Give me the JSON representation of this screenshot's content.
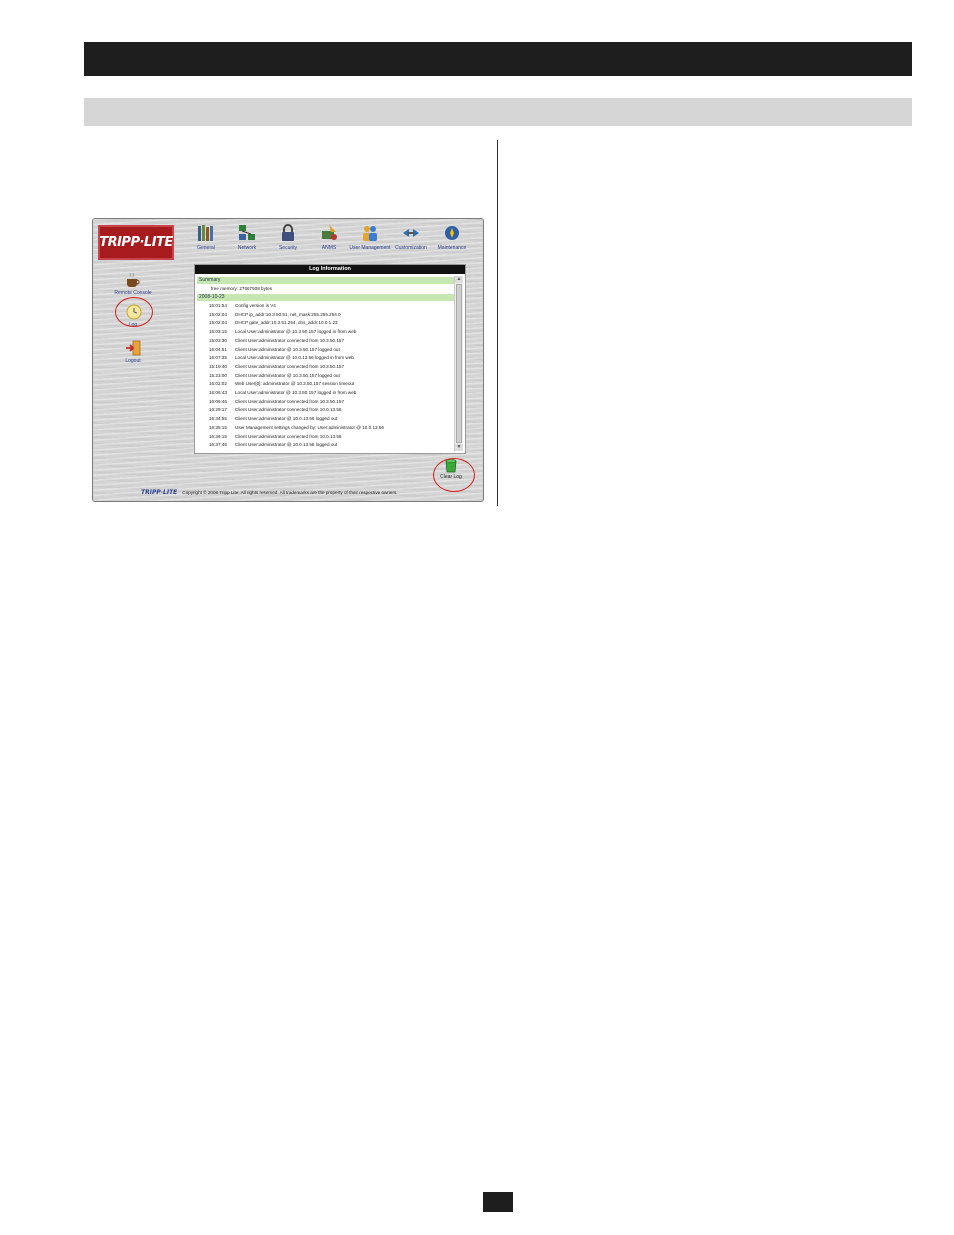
{
  "app": {
    "logo": "TRIPP·LITE",
    "footer_logo": "TRIPP·LITE",
    "copyright": "Copyright © 2008 Tripp Lite. All rights reserved. All trademarks are the property of their respective owners."
  },
  "nav": {
    "items": [
      {
        "label": "General",
        "icon": "books-icon"
      },
      {
        "label": "Network",
        "icon": "network-icon"
      },
      {
        "label": "Security",
        "icon": "lock-icon"
      },
      {
        "label": "ANMS",
        "icon": "anms-icon"
      },
      {
        "label": "User Management",
        "icon": "users-icon"
      },
      {
        "label": "Customization",
        "icon": "customization-icon"
      },
      {
        "label": "Maintenance",
        "icon": "maintenance-icon"
      }
    ]
  },
  "sidebar": {
    "items": [
      {
        "label": "Remote Console",
        "icon": "coffee-icon"
      },
      {
        "label": "Log",
        "icon": "log-icon"
      },
      {
        "label": "Logout",
        "icon": "logout-icon"
      }
    ]
  },
  "log": {
    "title": "Log  Information",
    "summary_label": "Summary",
    "free_memory": "free memory: 27667508 bytes",
    "date": "2008-10-23",
    "entries": [
      {
        "time": "15:01:54",
        "msg": "Config version is V4"
      },
      {
        "time": "15:02:04",
        "msg": "DHCP ip_addr:10.3.50.51, net_mask:255.255.254.0"
      },
      {
        "time": "15:02:04",
        "msg": "DHCP gate_addr:10.3.51.254, dns_addr:10.0.1.23"
      },
      {
        "time": "15:03:15",
        "msg": "Local User:administrator @ 10.3.50.157 logged in from web"
      },
      {
        "time": "15:03:30",
        "msg": "Client User:administrator connected from 10.3.50.157"
      },
      {
        "time": "15:04:51",
        "msg": "Client User:administrator @ 10.3.50.157 logged out"
      },
      {
        "time": "15:07:35",
        "msg": "Local User:administrator @ 10.0.13.56 logged in from web"
      },
      {
        "time": "15:19:40",
        "msg": "Client User:administrator connected from 10.3.50.157"
      },
      {
        "time": "15:23:00",
        "msg": "Client User:administrator @ 10.3.50.157 logged out"
      },
      {
        "time": "16:02:02",
        "msg": "Web User[0]: administrator @ 10.3.50.157 session timeout"
      },
      {
        "time": "16:06:43",
        "msg": "Local User:administrator @ 10.3.50.157 logged in from web"
      },
      {
        "time": "16:06:46",
        "msg": "Client User:administrator connected from 10.3.50.157"
      },
      {
        "time": "16:29:17",
        "msg": "Client User:administrator connected from 10.0.13.56"
      },
      {
        "time": "16:34:55",
        "msg": "Client User:administrator @ 10.0.13.56 logged out"
      },
      {
        "time": "16:35:15",
        "msg": "User Management settings changed by: User:administrator @ 10.0.13.56"
      },
      {
        "time": "16:36:15",
        "msg": "Client User:administrator connected from 10.0.13.56"
      },
      {
        "time": "16:37:46",
        "msg": "Client User:administrator @ 10.0.13.56 logged out"
      }
    ]
  },
  "clear_log": {
    "label": "Clear Log",
    "icon": "clear-log-icon"
  },
  "colors": {
    "header_bar": "#1e1e1e",
    "subheader_bar": "#d6d6d6",
    "logo_red": "#a71b1f",
    "highlight_circle": "#d0201f",
    "section_green": "#c6e7b2",
    "link_blue": "#2a3d8f"
  }
}
